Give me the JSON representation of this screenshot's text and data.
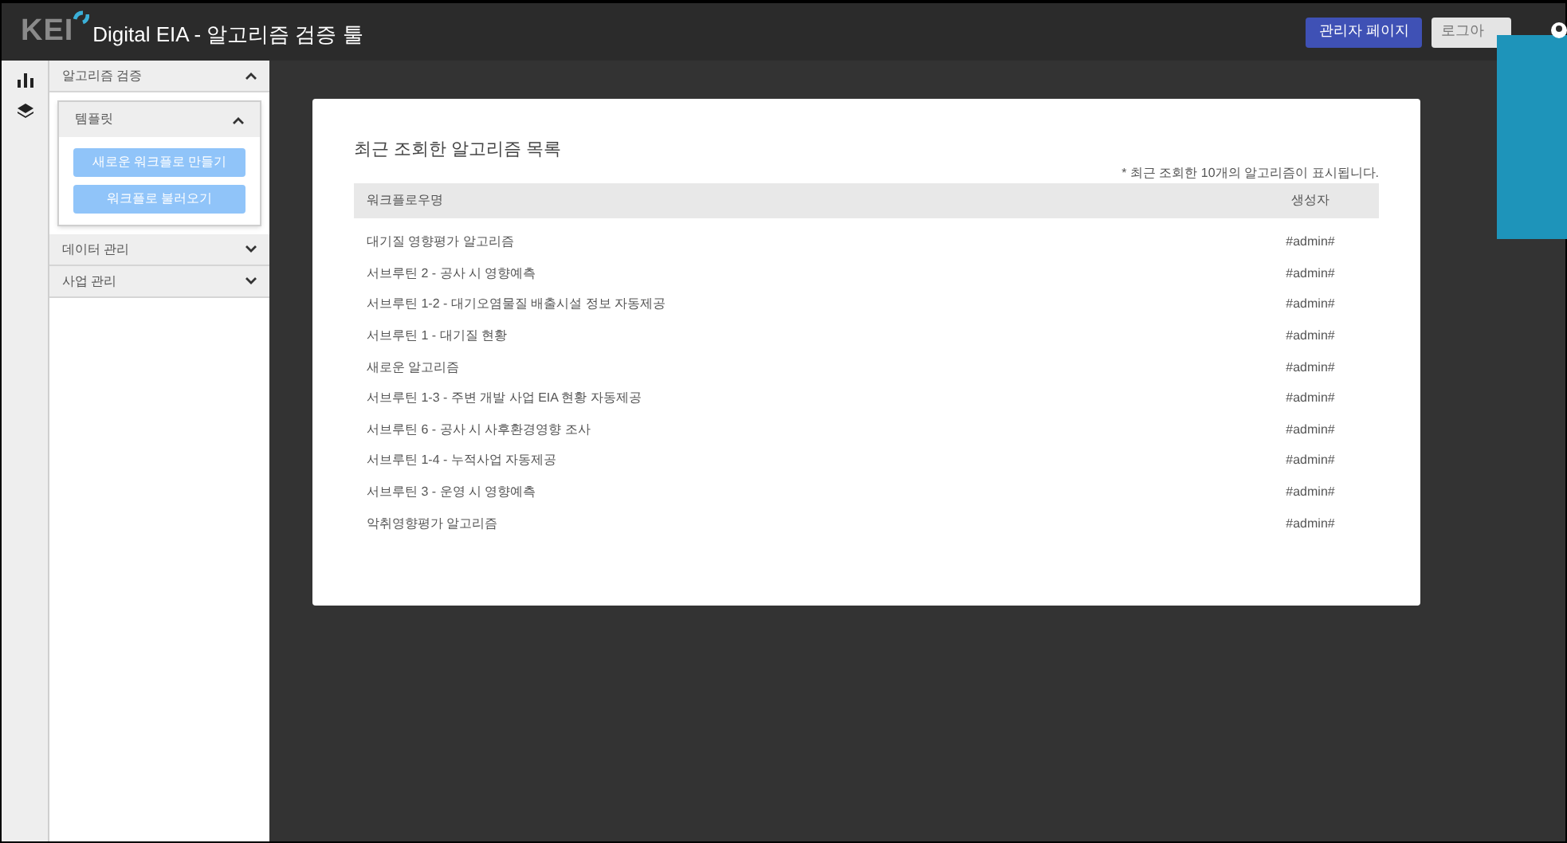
{
  "header": {
    "logo": "KEI",
    "title": "Digital EIA - 알고리즘 검증 툴",
    "admin_button": "관리자 페이지",
    "logout_button": "로그아"
  },
  "sidebar": {
    "sections": [
      {
        "label": "알고리즘 검증",
        "expanded": true,
        "children": [
          {
            "label": "템플릿",
            "expanded": true,
            "buttons": [
              "새로운 워크플로 만들기",
              "워크플로 불러오기"
            ]
          }
        ]
      },
      {
        "label": "데이터 관리",
        "expanded": false
      },
      {
        "label": "사업 관리",
        "expanded": false
      }
    ]
  },
  "card": {
    "title": "최근 조회한 알고리즘 목록",
    "note": "* 최근 조회한 10개의 알고리즘이 표시됩니다.",
    "columns": [
      "워크플로우명",
      "생성자"
    ],
    "rows": [
      [
        "대기질 영향평가 알고리즘",
        "#admin#"
      ],
      [
        "서브루틴 2 - 공사 시 영향예측",
        "#admin#"
      ],
      [
        "서브루틴 1-2 - 대기오염물질 배출시설 정보 자동제공",
        "#admin#"
      ],
      [
        "서브루틴 1 - 대기질 현황",
        "#admin#"
      ],
      [
        "새로운 알고리즘",
        "#admin#"
      ],
      [
        "서브루틴 1-3 - 주변 개발 사업 EIA 현황 자동제공",
        "#admin#"
      ],
      [
        "서브루틴 6 - 공사 시 사후환경영향 조사",
        "#admin#"
      ],
      [
        "서브루틴 1-4 - 누적사업 자동제공",
        "#admin#"
      ],
      [
        "서브루틴 3 - 운영 시 영향예측",
        "#admin#"
      ],
      [
        "악취영향평가 알고리즘",
        "#admin#"
      ]
    ]
  }
}
